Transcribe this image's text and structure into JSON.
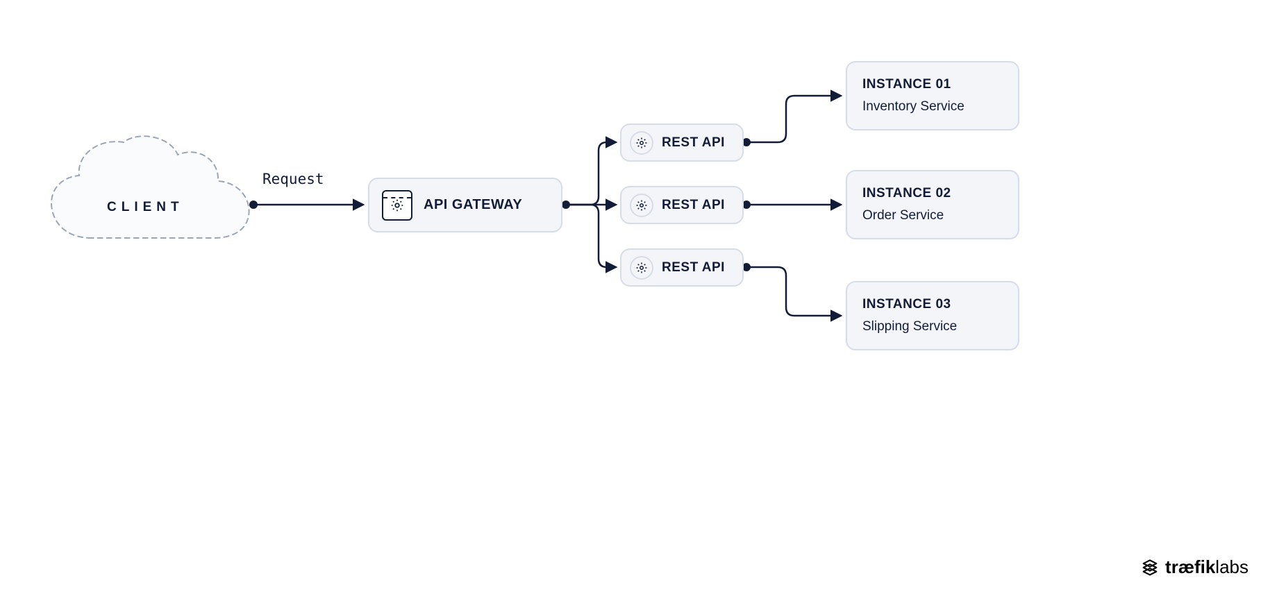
{
  "client": {
    "label": "CLIENT"
  },
  "request": {
    "label": "Request"
  },
  "gateway": {
    "label": "API GATEWAY"
  },
  "rest": [
    {
      "label": "REST API"
    },
    {
      "label": "REST API"
    },
    {
      "label": "REST API"
    }
  ],
  "instances": [
    {
      "title": "INSTANCE 01",
      "subtitle": "Inventory Service"
    },
    {
      "title": "INSTANCE 02",
      "subtitle": "Order Service"
    },
    {
      "title": "INSTANCE 03",
      "subtitle": "Slipping Service"
    }
  ],
  "brand": {
    "part1": "træfik",
    "part2": "labs"
  },
  "colors": {
    "stroke": "#121c36",
    "box_bg": "#f3f5f8",
    "box_border": "#d7dde6"
  }
}
